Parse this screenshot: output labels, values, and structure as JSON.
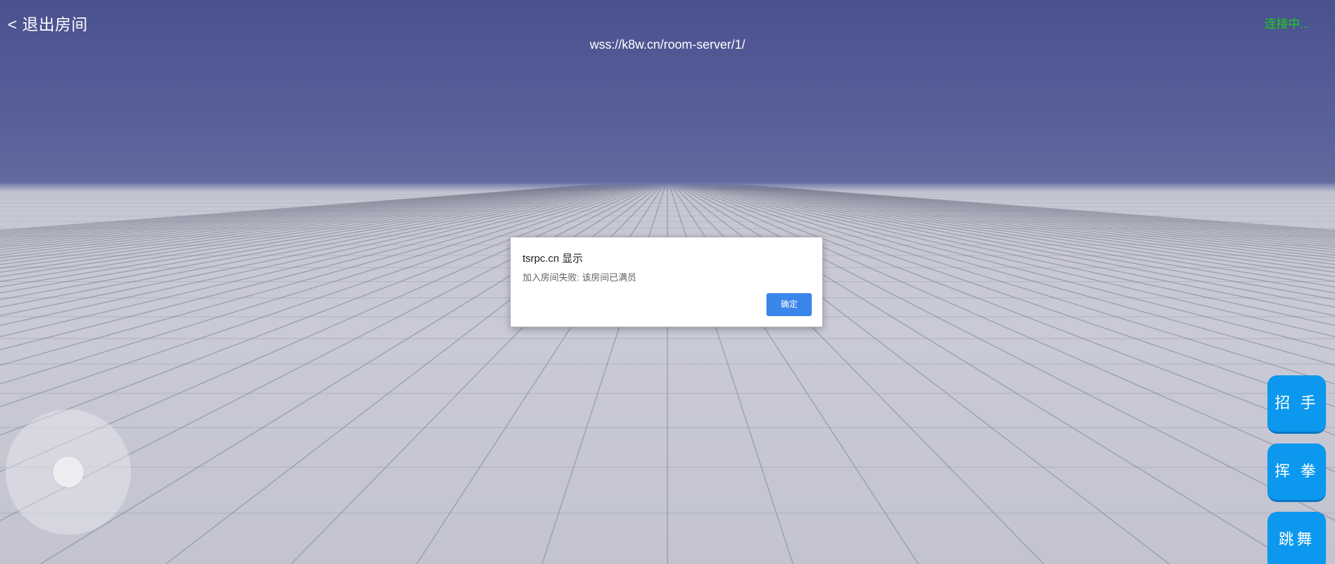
{
  "header": {
    "exit_label": "< 退出房间",
    "server_url": "wss://k8w.cn/room-server/1/",
    "status_text": "连接中..."
  },
  "colors": {
    "status": "#19d21a",
    "action_button": "#0b98ee",
    "dialog_button": "#3b86ea"
  },
  "actions": [
    {
      "label": "招 手"
    },
    {
      "label": "挥 拳"
    },
    {
      "label": "跳舞"
    }
  ],
  "dialog": {
    "title": "tsrpc.cn 显示",
    "message": "加入房间失败: 该房间已满员",
    "ok_label": "确定"
  }
}
